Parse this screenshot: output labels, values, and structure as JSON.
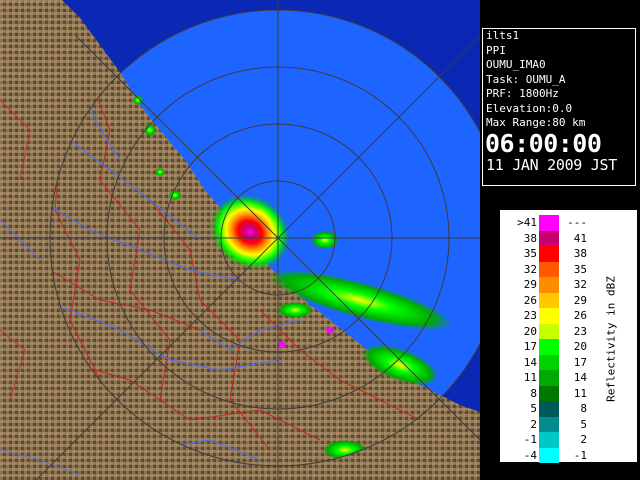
{
  "radar_info": {
    "station": "ilts1",
    "product": "PPI",
    "site": "OUMU_IMA0",
    "task": "Task: OUMU_A",
    "prf": "PRF: 1800Hz",
    "elevation": "Elevation:0.0",
    "max_range": "Max Range:80 km",
    "time": "06:00:00",
    "date": "11 JAN 2009 JST"
  },
  "legend": {
    "title": "Reflectivity in dBZ",
    "rows": [
      {
        "low": ">41",
        "high": "---",
        "color": "#ff00ff"
      },
      {
        "low": "38",
        "high": "41",
        "color": "#c8006e"
      },
      {
        "low": "35",
        "high": "38",
        "color": "#ff0000"
      },
      {
        "low": "32",
        "high": "35",
        "color": "#ff5a00"
      },
      {
        "low": "29",
        "high": "32",
        "color": "#ff8c00"
      },
      {
        "low": "26",
        "high": "29",
        "color": "#ffc800"
      },
      {
        "low": "23",
        "high": "26",
        "color": "#ffff00"
      },
      {
        "low": "20",
        "high": "23",
        "color": "#c8ff00"
      },
      {
        "low": "17",
        "high": "20",
        "color": "#00ff00"
      },
      {
        "low": "14",
        "high": "17",
        "color": "#00d200"
      },
      {
        "low": "11",
        "high": "14",
        "color": "#00aa00"
      },
      {
        "low": "8",
        "high": "11",
        "color": "#007800"
      },
      {
        "low": "5",
        "high": "8",
        "color": "#005a5a"
      },
      {
        "low": "2",
        "high": "5",
        "color": "#008c8c"
      },
      {
        "low": "-1",
        "high": "2",
        "color": "#00c8c8"
      },
      {
        "low": "-4",
        "high": "-1",
        "color": "#00ffff"
      }
    ]
  },
  "colors": {
    "sea_outer": "#0a28b4",
    "sea_inner": "#1e64ff",
    "land": "#8c7350",
    "rivers": "#4a6cff",
    "boundaries": "#c81e1e",
    "range_rings": "#3c3c3c"
  }
}
